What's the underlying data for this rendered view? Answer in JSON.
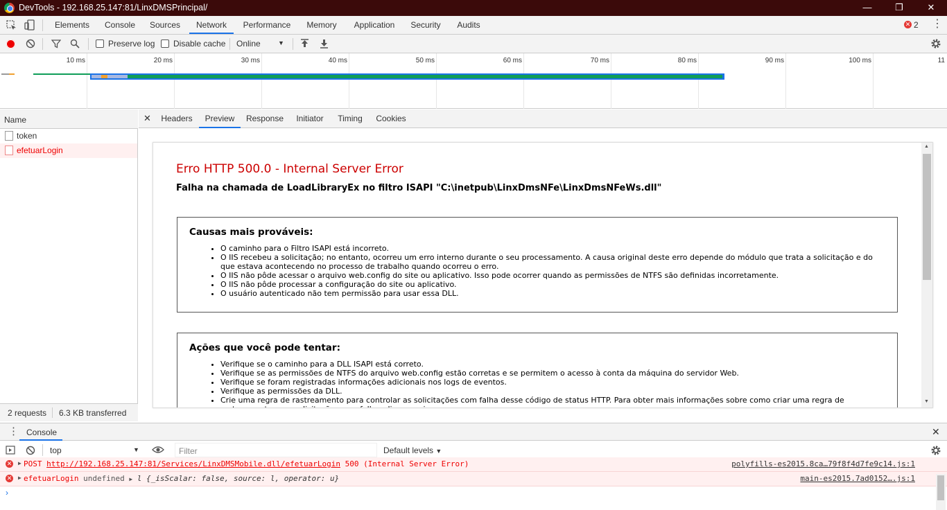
{
  "window": {
    "title": "DevTools - 192.168.25.147:81/LinxDMSPrincipal/"
  },
  "tabs": [
    "Elements",
    "Console",
    "Sources",
    "Network",
    "Performance",
    "Memory",
    "Application",
    "Security",
    "Audits"
  ],
  "active_tab": "Network",
  "error_count": "2",
  "toolbar": {
    "preserve_log": "Preserve log",
    "disable_cache": "Disable cache",
    "throttle": "Online"
  },
  "timeline_ticks": [
    "10 ms",
    "20 ms",
    "30 ms",
    "40 ms",
    "50 ms",
    "60 ms",
    "70 ms",
    "80 ms",
    "90 ms",
    "100 ms",
    "11"
  ],
  "requests": {
    "header": "Name",
    "items": [
      "token",
      "efetuarLogin"
    ],
    "footer_count": "2 requests",
    "footer_transferred": "6.3 KB transferred"
  },
  "detail_tabs": [
    "Headers",
    "Preview",
    "Response",
    "Initiator",
    "Timing",
    "Cookies"
  ],
  "active_detail_tab": "Preview",
  "preview": {
    "title": "Erro HTTP 500.0 - Internal Server Error",
    "subtitle": "Falha na chamada de LoadLibraryEx no filtro ISAPI \"C:\\inetpub\\LinxDmsNFe\\LinxDmsNFeWs.dll\"",
    "box1_title": "Causas mais prováveis:",
    "box1_items": [
      "O caminho para o Filtro ISAPI está incorreto.",
      "O IIS recebeu a solicitação; no entanto, ocorreu um erro interno durante o seu processamento. A causa original deste erro depende do módulo que trata a solicitação e do que estava acontecendo no processo de trabalho quando ocorreu o erro.",
      "O IIS não pôde acessar o arquivo web.config do site ou aplicativo. Isso pode ocorrer quando as permissões de NTFS são definidas incorretamente.",
      "O IIS não pôde processar a configuração do site ou aplicativo.",
      "O usuário autenticado não tem permissão para usar essa DLL."
    ],
    "box2_title": "Ações que você pode tentar:",
    "box2_items": [
      "Verifique se o caminho para a DLL ISAPI está correto.",
      "Verifique se as permissões de NTFS do arquivo web.config estão corretas e se permitem o acesso à conta da máquina do servidor Web.",
      "Verifique se foram registradas informações adicionais nos logs de eventos.",
      "Verifique as permissões da DLL.",
      "Crie uma regra de rastreamento para controlar as solicitações com falha desse código de status HTTP. Para obter mais informações sobre como criar uma regra de rastreamento para solicitações com falha, clique aqui."
    ]
  },
  "console": {
    "drawer_tab": "Console",
    "context": "top",
    "filter_placeholder": "Filter",
    "levels": "Default levels",
    "rows": [
      {
        "prefix": "POST",
        "url": "http://192.168.25.147:81/Services/LinxDMSMobile.dll/efetuarLogin",
        "status": "500 (Internal Server Error)",
        "source": "polyfills-es2015.8ca…79f8f4d7fe9c14.js:1"
      },
      {
        "prefix": "efetuarLogin",
        "value": "undefined",
        "object": "l {_isScalar: false, source: l, operator: u}",
        "source": "main-es2015.7ad0152….js:1"
      }
    ]
  },
  "colors": {
    "accent": "#1a73e8",
    "error": "#cc0000",
    "titlebar": "#3b0a0a"
  }
}
